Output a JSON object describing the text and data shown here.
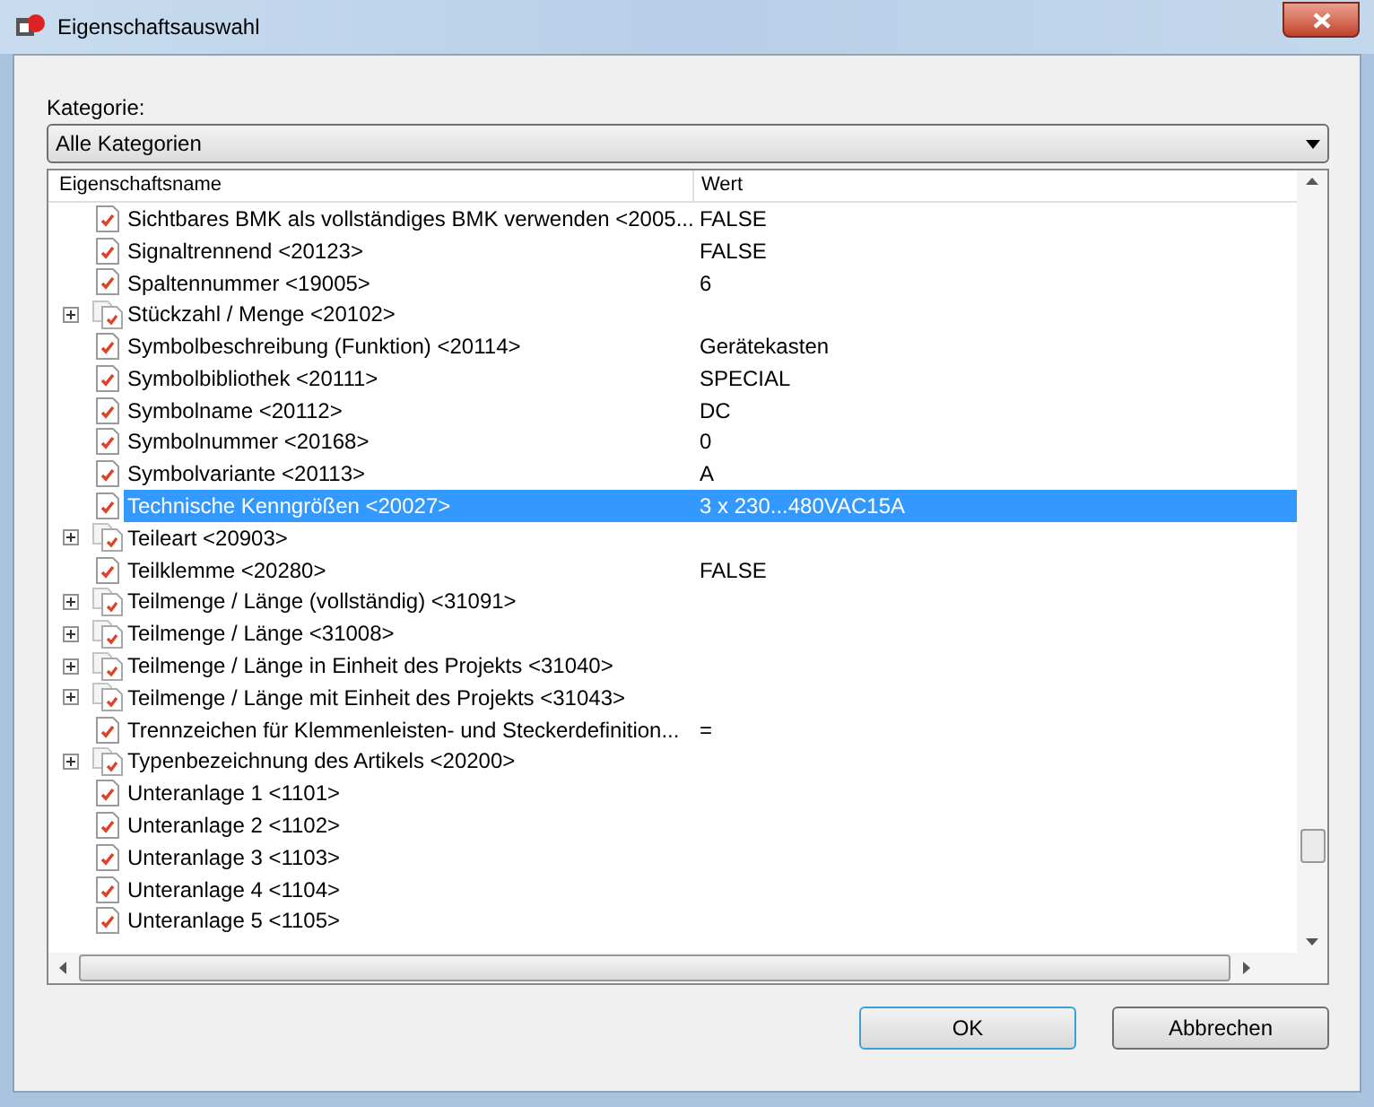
{
  "window": {
    "title": "Eigenschaftsauswahl"
  },
  "category": {
    "label": "Kategorie:",
    "value": "Alle Kategorien"
  },
  "table": {
    "columns": [
      "Eigenschaftsname",
      "Wert"
    ],
    "rows": [
      {
        "kind": "leaf",
        "name": "Sichtbares BMK als vollständiges BMK verwenden <2005...",
        "value": "FALSE",
        "selected": false
      },
      {
        "kind": "leaf",
        "name": "Signaltrennend <20123>",
        "value": "FALSE",
        "selected": false
      },
      {
        "kind": "leaf",
        "name": "Spaltennummer <19005>",
        "value": "6",
        "selected": false
      },
      {
        "kind": "group",
        "name": "Stückzahl / Menge <20102>",
        "expanded": false,
        "selected": false
      },
      {
        "kind": "leaf",
        "name": "Symbolbeschreibung (Funktion) <20114>",
        "value": "Gerätekasten",
        "selected": false
      },
      {
        "kind": "leaf",
        "name": "Symbolbibliothek <20111>",
        "value": "SPECIAL",
        "selected": false
      },
      {
        "kind": "leaf",
        "name": "Symbolname <20112>",
        "value": "DC",
        "selected": false
      },
      {
        "kind": "leaf",
        "name": "Symbolnummer <20168>",
        "value": "0",
        "selected": false
      },
      {
        "kind": "leaf",
        "name": "Symbolvariante <20113>",
        "value": "A",
        "selected": false
      },
      {
        "kind": "leaf",
        "name": "Technische Kenngrößen <20027>",
        "value": "3 x 230...480VAC15A",
        "selected": true
      },
      {
        "kind": "group",
        "name": "Teileart <20903>",
        "expanded": false,
        "selected": false
      },
      {
        "kind": "leaf",
        "name": "Teilklemme <20280>",
        "value": "FALSE",
        "selected": false
      },
      {
        "kind": "group",
        "name": "Teilmenge / Länge (vollständig) <31091>",
        "expanded": false,
        "selected": false
      },
      {
        "kind": "group",
        "name": "Teilmenge / Länge <31008>",
        "expanded": false,
        "selected": false
      },
      {
        "kind": "group",
        "name": "Teilmenge / Länge in Einheit des Projekts <31040>",
        "expanded": false,
        "selected": false
      },
      {
        "kind": "group",
        "name": "Teilmenge / Länge mit Einheit des Projekts <31043>",
        "expanded": false,
        "selected": false
      },
      {
        "kind": "leaf",
        "name": "Trennzeichen für Klemmenleisten- und Steckerdefinition...",
        "value": "=",
        "selected": false
      },
      {
        "kind": "group",
        "name": "Typenbezeichnung des Artikels <20200>",
        "expanded": false,
        "selected": false
      },
      {
        "kind": "leaf",
        "name": "Unteranlage 1 <1101>",
        "selected": false
      },
      {
        "kind": "leaf",
        "name": "Unteranlage 2 <1102>",
        "selected": false
      },
      {
        "kind": "leaf",
        "name": "Unteranlage 3 <1103>",
        "selected": false
      },
      {
        "kind": "leaf",
        "name": "Unteranlage 4 <1104>",
        "selected": false
      },
      {
        "kind": "leaf",
        "name": "Unteranlage 5 <1105>",
        "selected": false
      }
    ]
  },
  "buttons": [
    {
      "label": "OK",
      "kind": "default"
    },
    {
      "label": "Abbrechen",
      "kind": "normal"
    }
  ]
}
